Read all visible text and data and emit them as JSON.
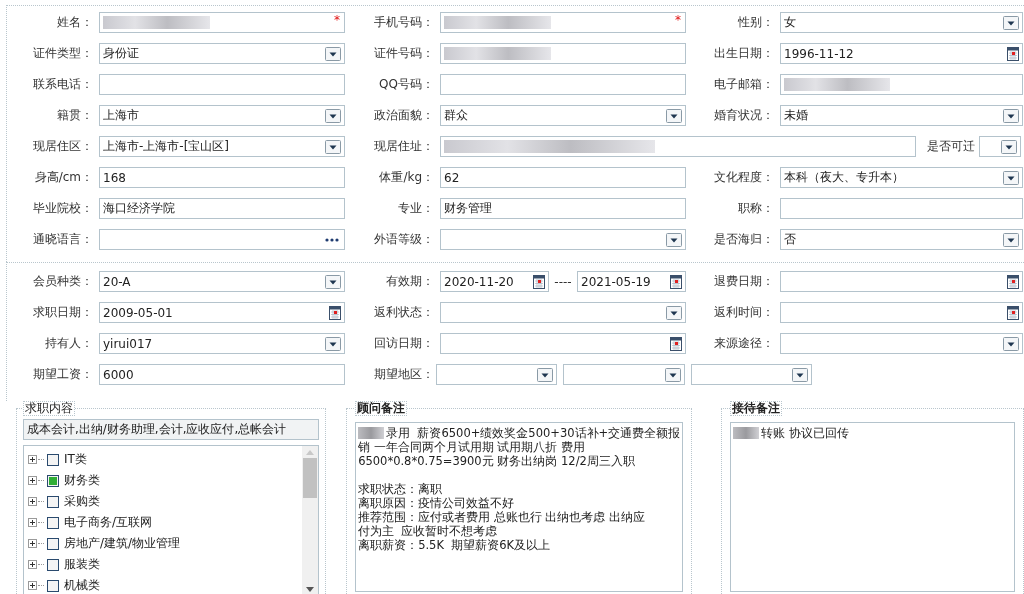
{
  "personal_rows": [
    [
      {
        "label": "姓名：",
        "fields": [
          {
            "kind": "masked",
            "required_mark": "*"
          }
        ]
      },
      {
        "label": "手机号码：",
        "fields": [
          {
            "kind": "masked",
            "required_mark": "*"
          }
        ]
      },
      {
        "label": "性别：",
        "fields": [
          {
            "kind": "select",
            "value": "女"
          }
        ]
      }
    ],
    [
      {
        "label": "证件类型：",
        "fields": [
          {
            "kind": "select",
            "value": "身份证"
          }
        ]
      },
      {
        "label": "证件号码：",
        "fields": [
          {
            "kind": "masked"
          }
        ]
      },
      {
        "label": "出生日期：",
        "fields": [
          {
            "kind": "date",
            "value": "1996-11-12"
          }
        ]
      }
    ],
    [
      {
        "label": "联系电话：",
        "fields": [
          {
            "kind": "text"
          }
        ]
      },
      {
        "label": "QQ号码：",
        "fields": [
          {
            "kind": "text"
          }
        ]
      },
      {
        "label": "电子邮箱：",
        "fields": [
          {
            "kind": "masked"
          }
        ]
      }
    ],
    [
      {
        "label": "籍贯：",
        "fields": [
          {
            "kind": "select",
            "value": "上海市"
          }
        ]
      },
      {
        "label": "政治面貌：",
        "fields": [
          {
            "kind": "select",
            "value": "群众"
          }
        ]
      },
      {
        "label": "婚育状况：",
        "fields": [
          {
            "kind": "select",
            "value": "未婚"
          }
        ]
      }
    ],
    [
      {
        "label": "现居住区：",
        "fields": [
          {
            "kind": "select",
            "value": " 上海市-上海市-[宝山区]"
          }
        ]
      },
      {
        "label": "现居住址：",
        "fields": [
          {
            "kind": "masked"
          }
        ]
      },
      {
        "label": "是否可迁",
        "fields": [
          {
            "kind": "select"
          }
        ]
      }
    ],
    [
      {
        "label": "身高/cm：",
        "fields": [
          {
            "kind": "text",
            "value": "168"
          }
        ]
      },
      {
        "label": "体重/kg：",
        "fields": [
          {
            "kind": "text",
            "value": "62"
          }
        ]
      },
      {
        "label": "文化程度：",
        "fields": [
          {
            "kind": "select",
            "value": "本科（夜大、专升本）"
          }
        ]
      }
    ],
    [
      {
        "label": "毕业院校：",
        "fields": [
          {
            "kind": "text",
            "value": "海口经济学院"
          }
        ]
      },
      {
        "label": "专业：",
        "fields": [
          {
            "kind": "text",
            "value": "财务管理"
          }
        ]
      },
      {
        "label": "职称：",
        "fields": [
          {
            "kind": "text"
          }
        ]
      }
    ],
    [
      {
        "label": "通晓语言：",
        "fields": [
          {
            "kind": "picker"
          }
        ]
      },
      {
        "label": "外语等级：",
        "fields": [
          {
            "kind": "select"
          }
        ]
      },
      {
        "label": "是否海归：",
        "fields": [
          {
            "kind": "select",
            "value": "否"
          }
        ]
      }
    ]
  ],
  "member_rows": [
    [
      {
        "label": "会员种类：",
        "fields": [
          {
            "kind": "select",
            "value": "20-A"
          }
        ]
      },
      {
        "label": "有效期：",
        "separator": "----",
        "fields": [
          {
            "kind": "date",
            "value": "2020-11-20"
          },
          {
            "kind": "date",
            "value": "2021-05-19"
          }
        ]
      },
      {
        "label": "退费日期：",
        "fields": [
          {
            "kind": "date"
          }
        ]
      }
    ],
    [
      {
        "label": "求职日期：",
        "fields": [
          {
            "kind": "date",
            "value": "2009-05-01"
          }
        ]
      },
      {
        "label": "返利状态：",
        "fields": [
          {
            "kind": "select"
          }
        ]
      },
      {
        "label": "返利时间：",
        "fields": [
          {
            "kind": "date"
          }
        ]
      }
    ],
    [
      {
        "label": "持有人：",
        "fields": [
          {
            "kind": "select",
            "value": "yirui017"
          }
        ]
      },
      {
        "label": "回访日期：",
        "fields": [
          {
            "kind": "date"
          }
        ]
      },
      {
        "label": "来源途径：",
        "fields": [
          {
            "kind": "select"
          }
        ]
      }
    ],
    [
      {
        "label": "期望工资：",
        "fields": [
          {
            "kind": "text",
            "value": "6000"
          }
        ]
      },
      {
        "label": "期望地区：",
        "fields": [
          {
            "kind": "select"
          },
          {
            "kind": "select"
          },
          {
            "kind": "select"
          }
        ]
      }
    ]
  ],
  "job_intent": {
    "title": "求职内容",
    "summary": "成本会计,出纳/财务助理,会计,应收应付,总帐会计",
    "categories": [
      {
        "label": "IT类",
        "checked": false
      },
      {
        "label": "财务类",
        "checked": true
      },
      {
        "label": "采购类",
        "checked": false
      },
      {
        "label": "电子商务/互联网",
        "checked": false
      },
      {
        "label": "房地产/建筑/物业管理",
        "checked": false
      },
      {
        "label": "服装类",
        "checked": false
      },
      {
        "label": "机械类",
        "checked": false
      }
    ]
  },
  "consultant_notes": {
    "title": "顾问备注",
    "paragraphs": [
      {
        "masked_prefix": true,
        "lines": [
          "录用  薪资6500+绩效奖金500+30话补+交通费全额报",
          "销 一年合同两个月试用期 试用期八折 费用",
          "6500*0.8*0.75=3900元 财务出纳岗 12/2周三入职"
        ]
      },
      {
        "masked_prefix": false,
        "lines": [
          "求职状态：离职",
          "离职原因：疫情公司效益不好",
          "推荐范围：应付或者费用 总账也行 出纳也考虑 出纳应",
          "付为主  应收暂时不想考虑",
          "离职薪资：5.5K  期望薪资6K及以上"
        ]
      }
    ]
  },
  "reception_notes": {
    "title": "接待备注",
    "paragraphs": [
      {
        "masked_prefix": true,
        "lines": [
          "转账 协议已回传"
        ]
      }
    ]
  }
}
